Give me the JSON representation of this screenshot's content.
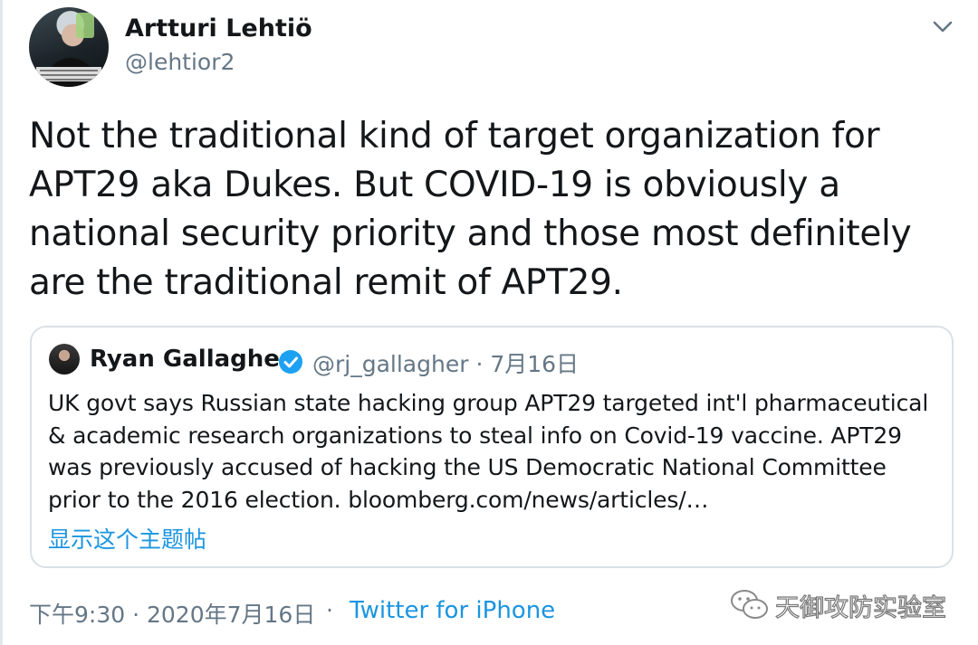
{
  "author": {
    "display_name": "Artturi Lehtiö",
    "handle": "@lehtior2"
  },
  "tweet": {
    "text": "Not the traditional kind of target organization for APT29 aka Dukes. But COVID-19 is obviously a national security priority and those most definitely are the traditional remit of APT29."
  },
  "quoted_tweet": {
    "display_name": "Ryan Gallagher",
    "meta": "@rj_gallagher · 7月16日",
    "text": "UK govt says Russian state hacking group APT29 targeted int'l pharmaceutical & academic research organizations to steal info on Covid-19 vaccine. APT29 was previously accused of hacking the US Democratic National Committee prior to the 2016 election. bloomberg.com/news/articles/…",
    "show_thread_label": "显示这个主题帖"
  },
  "footer": {
    "timestamp": "下午9:30 · 2020年7月16日",
    "separator": "·",
    "source": "Twitter for iPhone"
  },
  "watermark": {
    "text": "天御攻防实验室"
  },
  "icons": {
    "menu": "chevron-down-icon",
    "verified": "verified-badge-icon",
    "watermark": "wechat-icon"
  },
  "colors": {
    "link": "#1b95e0",
    "secondary_text": "#657786",
    "verified": "#1da1f2"
  }
}
